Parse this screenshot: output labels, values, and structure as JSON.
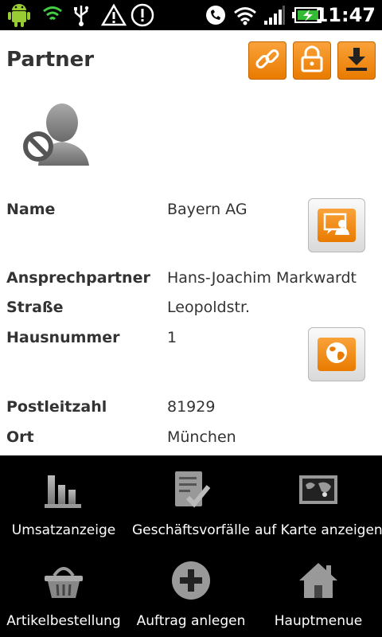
{
  "status_bar": {
    "time": "11:47",
    "icons": [
      "android-icon",
      "shield-icon",
      "usb-icon",
      "warning-icon",
      "alert-icon",
      "phone-icon",
      "wifi-icon",
      "signal-icon",
      "battery-icon"
    ]
  },
  "header": {
    "title": "Partner",
    "actions": [
      "link-icon",
      "lock-icon",
      "download-icon"
    ]
  },
  "accent_color": "#f28c00",
  "details": [
    {
      "label": "Name",
      "value": "Bayern AG"
    },
    {
      "label": "Ansprechpartner",
      "value": "Hans-Joachim Markwardt"
    },
    {
      "label": "Straße",
      "value": "Leopoldstr."
    },
    {
      "label": "Hausnummer",
      "value": "1"
    },
    {
      "label": "Postleitzahl",
      "value": "81929"
    },
    {
      "label": "Ort",
      "value": "München"
    }
  ],
  "menu": [
    {
      "label": "Umsatzanzeige",
      "icon": "bar-chart-icon"
    },
    {
      "label": "Geschäftsvorfälle",
      "icon": "checklist-icon"
    },
    {
      "label": "auf Karte anzeigen",
      "icon": "map-icon"
    },
    {
      "label": "Artikelbestellung",
      "icon": "basket-icon"
    },
    {
      "label": "Auftrag anlegen",
      "icon": "add-icon"
    },
    {
      "label": "Hauptmenue",
      "icon": "home-icon"
    }
  ]
}
